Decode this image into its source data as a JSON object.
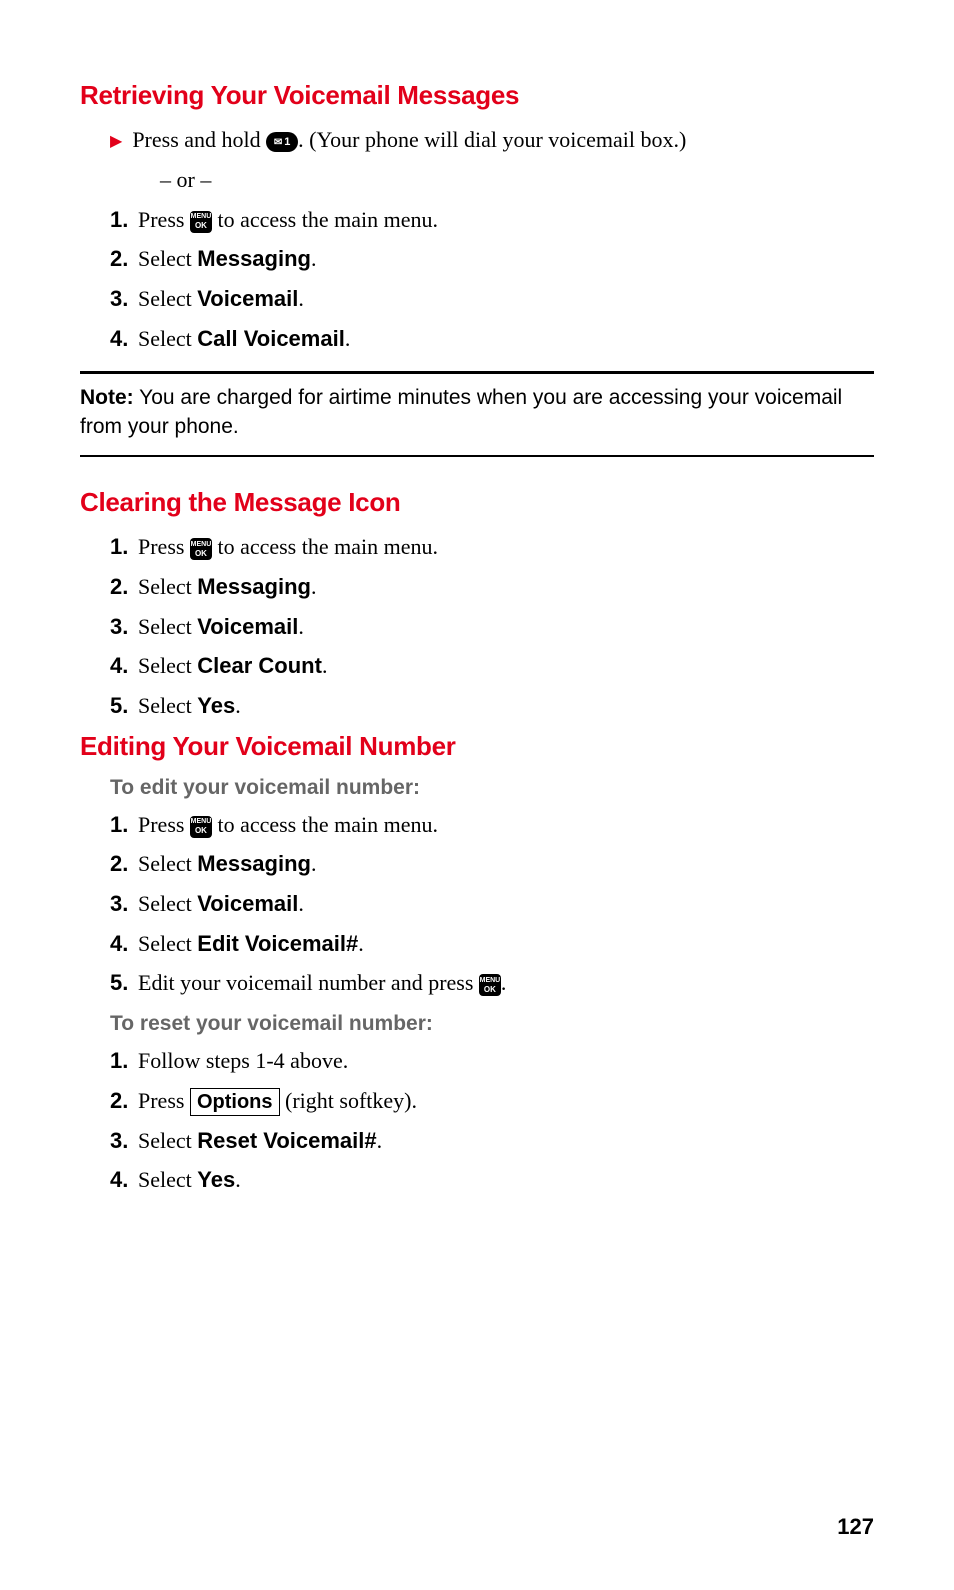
{
  "page_number": "127",
  "section1": {
    "heading": "Retrieving Your Voicemail Messages",
    "bullet_pre": "Press and hold ",
    "bullet_post": ". (Your phone will dial your voicemail box.)",
    "or": "– or –",
    "steps": [
      {
        "num": "1.",
        "pre": "Press ",
        "post": " to access the main menu."
      },
      {
        "num": "2.",
        "pre": "Select ",
        "bold": "Messaging",
        "post": "."
      },
      {
        "num": "3.",
        "pre": "Select ",
        "bold": "Voicemail",
        "post": "."
      },
      {
        "num": "4.",
        "pre": "Select ",
        "bold": "Call Voicemail",
        "post": "."
      }
    ]
  },
  "note": {
    "label": "Note:",
    "text": " You are charged for airtime minutes when you are accessing your voicemail from your phone."
  },
  "section2": {
    "heading": "Clearing the Message Icon",
    "steps": [
      {
        "num": "1.",
        "pre": "Press ",
        "post": " to access the main menu."
      },
      {
        "num": "2.",
        "pre": "Select ",
        "bold": "Messaging",
        "post": "."
      },
      {
        "num": "3.",
        "pre": "Select ",
        "bold": "Voicemail",
        "post": "."
      },
      {
        "num": "4.",
        "pre": "Select ",
        "bold": "Clear Count",
        "post": "."
      },
      {
        "num": "5.",
        "pre": "Select ",
        "bold": "Yes",
        "post": "."
      }
    ]
  },
  "section3": {
    "heading": "Editing Your Voicemail Number",
    "sub1": "To edit your voicemail number:",
    "steps1": [
      {
        "num": "1.",
        "pre": "Press ",
        "post": " to access the main menu."
      },
      {
        "num": "2.",
        "pre": "Select ",
        "bold": "Messaging",
        "post": "."
      },
      {
        "num": "3.",
        "pre": "Select ",
        "bold": "Voicemail",
        "post": "."
      },
      {
        "num": "4.",
        "pre": "Select ",
        "bold": "Edit Voicemail#",
        "post": "."
      },
      {
        "num": "5.",
        "pre": "Edit your voicemail number and press ",
        "post": "."
      }
    ],
    "sub2": "To reset your voicemail number:",
    "steps2": [
      {
        "num": "1.",
        "text": "Follow steps 1-4 above."
      },
      {
        "num": "2.",
        "pre": "Press ",
        "softkey": "Options",
        "post": " (right softkey)."
      },
      {
        "num": "3.",
        "pre": "Select ",
        "bold": "Reset Voicemail#",
        "post": "."
      },
      {
        "num": "4.",
        "pre": "Select ",
        "bold": "Yes",
        "post": "."
      }
    ]
  },
  "icons": {
    "key1": "1",
    "menu": "MENU",
    "ok": "OK"
  }
}
